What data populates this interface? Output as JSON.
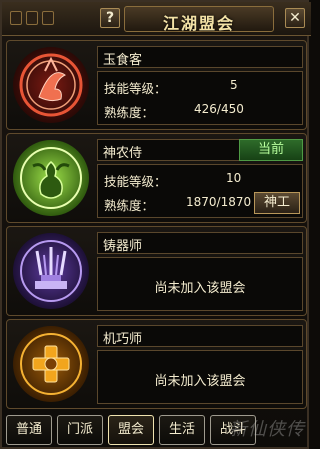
{
  "window": {
    "title": "江湖盟会",
    "help_label": "?",
    "close_label": "✕"
  },
  "professions": [
    {
      "name": "玉食客",
      "skill_label": "技能等级：",
      "skill_value": "5",
      "mastery_label": "熟练度：",
      "mastery_value": "426/450",
      "status": "",
      "emblem": "flame-dragon-emblem",
      "accent": "#c43b2a"
    },
    {
      "name": "神农侍",
      "skill_label": "技能等级：",
      "skill_value": "10",
      "mastery_label": "熟练度：",
      "mastery_value": "1870/1870",
      "status": "当前",
      "action_label": "神工",
      "emblem": "gourd-leaf-emblem",
      "accent": "#7fd12a"
    },
    {
      "name": "铸器师",
      "note": "尚未加入该盟会",
      "emblem": "forge-weapon-emblem",
      "accent": "#8e6ad8"
    },
    {
      "name": "机巧师",
      "note": "尚未加入该盟会",
      "emblem": "gear-mechanism-emblem",
      "accent": "#e7a019"
    }
  ],
  "tabs": [
    {
      "label": "普通",
      "active": false
    },
    {
      "label": "门派",
      "active": false
    },
    {
      "label": "盟会",
      "active": true
    },
    {
      "label": "生活",
      "active": false
    },
    {
      "label": "战斗",
      "active": false
    }
  ],
  "watermark": "新仙侠传"
}
